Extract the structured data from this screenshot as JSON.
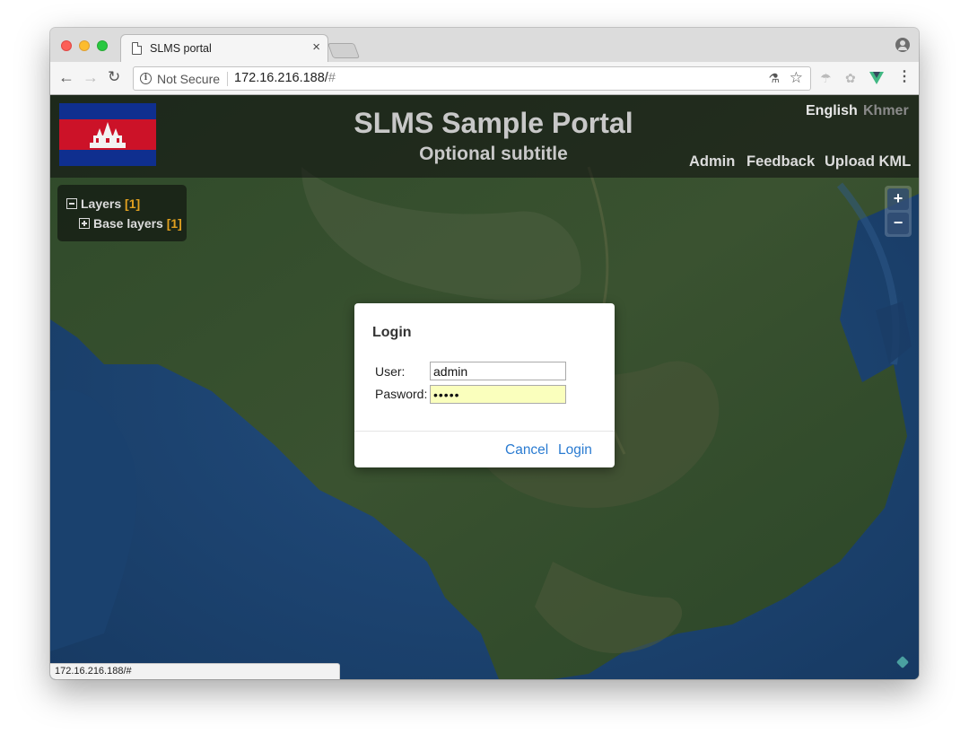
{
  "browser": {
    "tab_title": "SLMS portal",
    "tab_close": "×",
    "security_label": "Not Secure",
    "url_host": "172.16.216.188/",
    "url_hash": "#",
    "status_url": "172.16.216.188/#"
  },
  "header": {
    "title": "SLMS Sample Portal",
    "subtitle": "Optional subtitle",
    "languages": [
      "English",
      "Khmer"
    ],
    "links": [
      "Admin",
      "Feedback",
      "Upload KML"
    ]
  },
  "layers": {
    "root_label": "Layers",
    "root_count": "[1]",
    "child_label": "Base layers",
    "child_count": "[1]"
  },
  "zoom": {
    "in": "+",
    "out": "−"
  },
  "login_dialog": {
    "title": "Login",
    "user_label": "User:",
    "user_value": "admin",
    "password_label": "Pasword:",
    "password_value": "•••••",
    "cancel_label": "Cancel",
    "login_label": "Login"
  }
}
